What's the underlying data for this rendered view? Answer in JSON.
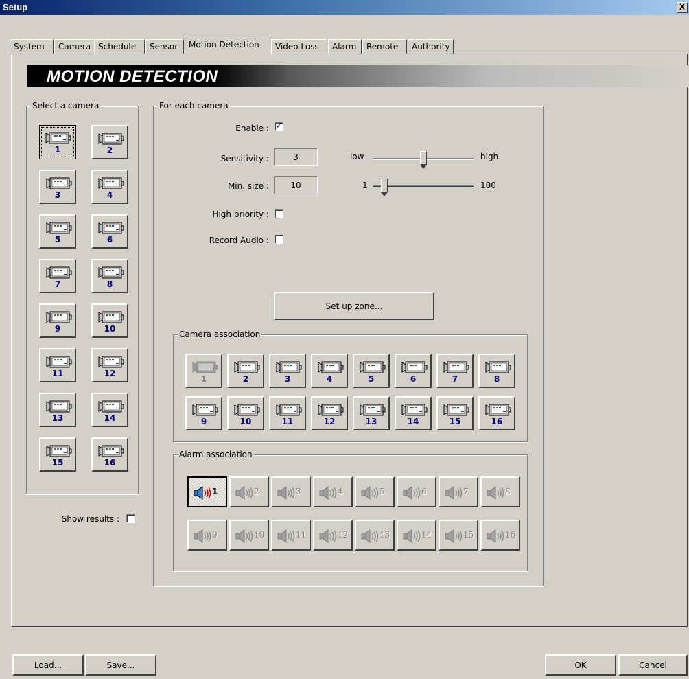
{
  "window": {
    "title": "Setup",
    "close_label": "X"
  },
  "tabs": [
    {
      "label": "System"
    },
    {
      "label": "Camera"
    },
    {
      "label": "Schedule"
    },
    {
      "label": "Sensor"
    },
    {
      "label": "Motion Detection",
      "active": true
    },
    {
      "label": "Video Loss"
    },
    {
      "label": "Alarm"
    },
    {
      "label": "Remote"
    },
    {
      "label": "Authority"
    }
  ],
  "banner": {
    "title": "MOTION DETECTION"
  },
  "select_camera": {
    "legend": "Select a camera",
    "cameras": [
      "1",
      "2",
      "3",
      "4",
      "5",
      "6",
      "7",
      "8",
      "9",
      "10",
      "11",
      "12",
      "13",
      "14",
      "15",
      "16"
    ],
    "selected": "1"
  },
  "show_results": {
    "label": "Show results :",
    "checked": false
  },
  "for_each_camera": {
    "legend": "For each camera",
    "enable": {
      "label": "Enable :",
      "checked": true,
      "mark": "✓"
    },
    "sensitivity": {
      "label": "Sensitivity :",
      "value": "3",
      "low_label": "low",
      "high_label": "high",
      "level": 3,
      "min": 1,
      "max": 5
    },
    "min_size": {
      "label": "Min. size :",
      "value": "10",
      "low_label": "1",
      "high_label": "100",
      "level": 10,
      "min": 1,
      "max": 100
    },
    "high_priority": {
      "label": "High priority :",
      "checked": false
    },
    "record_audio": {
      "label": "Record Audio :",
      "checked": false
    },
    "setup_zone_label": "Set up zone..."
  },
  "camera_association": {
    "legend": "Camera association",
    "cameras": [
      "1",
      "2",
      "3",
      "4",
      "5",
      "6",
      "7",
      "8",
      "9",
      "10",
      "11",
      "12",
      "13",
      "14",
      "15",
      "16"
    ],
    "disabled": "1"
  },
  "alarm_association": {
    "legend": "Alarm association",
    "alarms": [
      "1",
      "2",
      "3",
      "4",
      "5",
      "6",
      "7",
      "8",
      "9",
      "10",
      "11",
      "12",
      "13",
      "14",
      "15",
      "16"
    ],
    "selected": "1"
  },
  "footer": {
    "load_label": "Load...",
    "save_label": "Save...",
    "ok_label": "OK",
    "cancel_label": "Cancel"
  },
  "colors": {
    "face": "#d4d0c8",
    "number_blue": "#000080",
    "speaker_active": "#cc0000"
  },
  "icons": {
    "camera": "camera-icon",
    "speaker": "speaker-icon"
  }
}
